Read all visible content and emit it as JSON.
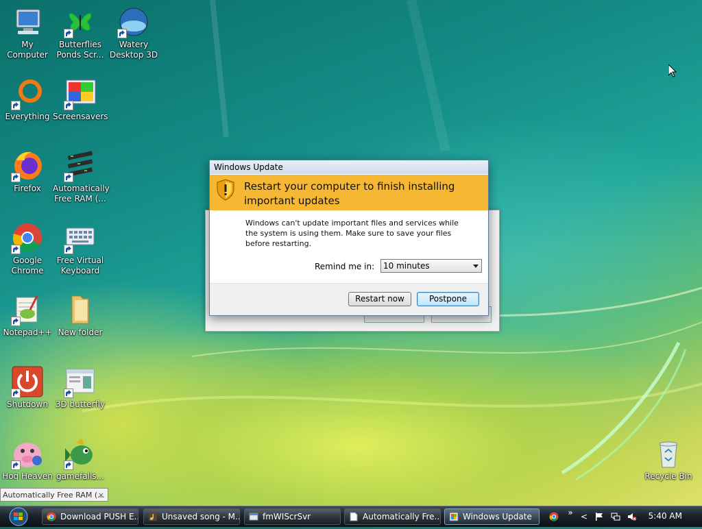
{
  "desktop": {
    "icons": [
      {
        "label": "My Computer",
        "icon": "computer-icon",
        "shortcut": false
      },
      {
        "label": "Butterflies Ponds Scr...",
        "icon": "butterfly-icon",
        "shortcut": true
      },
      {
        "label": "Watery Desktop 3D",
        "icon": "globe-icon",
        "shortcut": true
      },
      {
        "label": "Everything",
        "icon": "search-ring-icon",
        "shortcut": true
      },
      {
        "label": "Screensavers",
        "icon": "screensaver-icon",
        "shortcut": true
      },
      {
        "label": "Firefox",
        "icon": "firefox-icon",
        "shortcut": true
      },
      {
        "label": "Automatically Free RAM (...",
        "icon": "ram-icon",
        "shortcut": true
      },
      {
        "label": "Google Chrome",
        "icon": "chrome-icon",
        "shortcut": true
      },
      {
        "label": "Free Virtual Keyboard",
        "icon": "keyboard-icon",
        "shortcut": true
      },
      {
        "label": "Notepad++",
        "icon": "notepad-icon",
        "shortcut": true
      },
      {
        "label": "New folder",
        "icon": "folder-icon",
        "shortcut": false
      },
      {
        "label": "Shutdown",
        "icon": "power-icon",
        "shortcut": true
      },
      {
        "label": "3D butterfly",
        "icon": "window-icon",
        "shortcut": true
      },
      {
        "label": "Hog Heaven Buddy Race",
        "icon": "pig-icon",
        "shortcut": true
      },
      {
        "label": "gamefalls...",
        "icon": "fish-icon",
        "shortcut": true
      },
      {
        "label": "Recycle Bin",
        "icon": "recycle-bin-icon",
        "shortcut": false
      }
    ]
  },
  "dialog": {
    "title": "Windows Update",
    "heading": "Restart your computer to finish installing important updates",
    "message": "Windows can't update important files and services while the system is using them. Make sure to save your files before restarting.",
    "remind_label": "Remind me in:",
    "remind_value": "10 minutes",
    "restart_label": "Restart now",
    "postpone_label": "Postpone",
    "banner_color": "#f6b832"
  },
  "tooltip": {
    "text": "Automatically Free RAM (...",
    "close": "×"
  },
  "taskbar": {
    "tasks": [
      {
        "label": "Download PUSH E...",
        "icon": "chrome-icon",
        "active": false
      },
      {
        "label": "Unsaved song - M...",
        "icon": "music-icon",
        "active": false
      },
      {
        "label": "fmWIScrSvr",
        "icon": "app-window-icon",
        "active": false
      },
      {
        "label": "Automatically Fre...",
        "icon": "document-icon",
        "active": false
      },
      {
        "label": "Windows Update",
        "icon": "windows-update-icon",
        "active": true
      }
    ],
    "tray": {
      "overflow": "»",
      "chevron": "<",
      "clock": "5:40 AM"
    }
  }
}
